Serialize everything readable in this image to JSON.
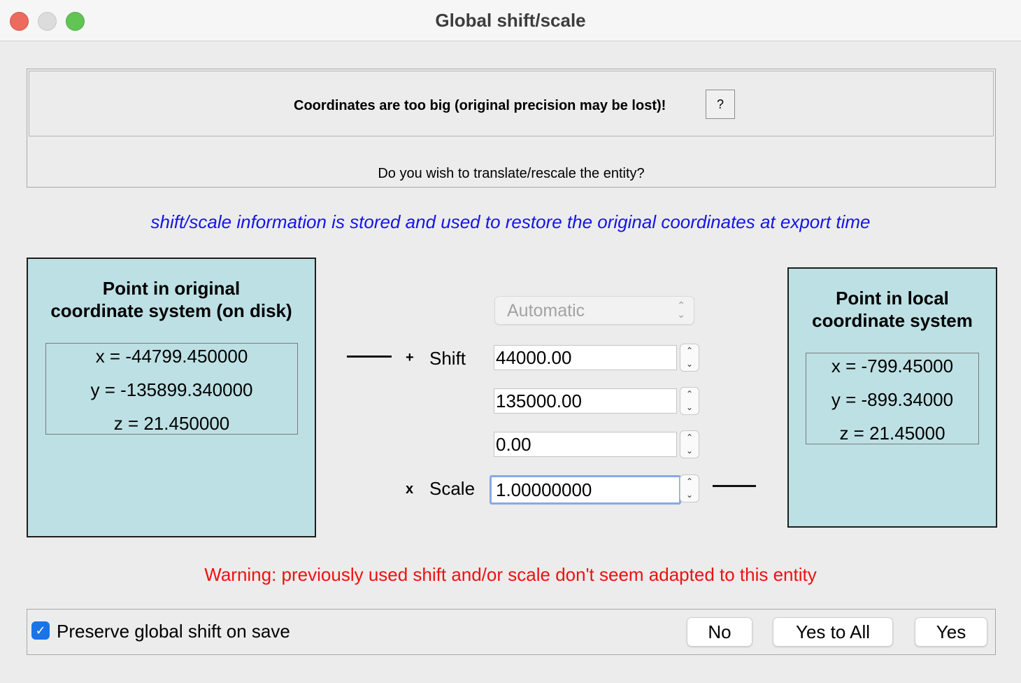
{
  "window": {
    "title": "Global shift/scale",
    "traffic_lights": [
      "close",
      "minimize",
      "zoom"
    ]
  },
  "header": {
    "warning": "Coordinates are too big (original precision may be lost)!",
    "help_label": "?",
    "question": "Do you wish to translate/rescale the entity?"
  },
  "info_text": "shift/scale information is stored and used to restore the original coordinates at export time",
  "original_point": {
    "title_line1": "Point in original",
    "title_line2": "coordinate system (on disk)",
    "x": "x = -44799.450000",
    "y": "y = -135899.340000",
    "z": "z = 21.450000"
  },
  "local_point": {
    "title_line1": "Point in local",
    "title_line2": "coordinate system",
    "x": "x = -799.45000",
    "y": "y = -899.34000",
    "z": "z = 21.45000"
  },
  "transform": {
    "mode": "Automatic",
    "plus_sign": "+",
    "shift_label": "Shift",
    "shift_x": "44000.00",
    "shift_y": "135000.00",
    "shift_z": "0.00",
    "times_sign": "x",
    "scale_label": "Scale",
    "scale": "1.00000000"
  },
  "warning_text": "Warning: previously used shift and/or scale don't seem adapted to this entity",
  "footer": {
    "preserve_label": "Preserve global shift on save",
    "preserve_checked": true,
    "no_label": "No",
    "yes_all_label": "Yes to All",
    "yes_label": "Yes"
  },
  "colors": {
    "panel_bg": "#bde0e4",
    "info_blue": "#1414e6",
    "warning_red": "#ee1111",
    "checkbox_blue": "#1a74e8",
    "focus_ring": "#86a9e8"
  }
}
